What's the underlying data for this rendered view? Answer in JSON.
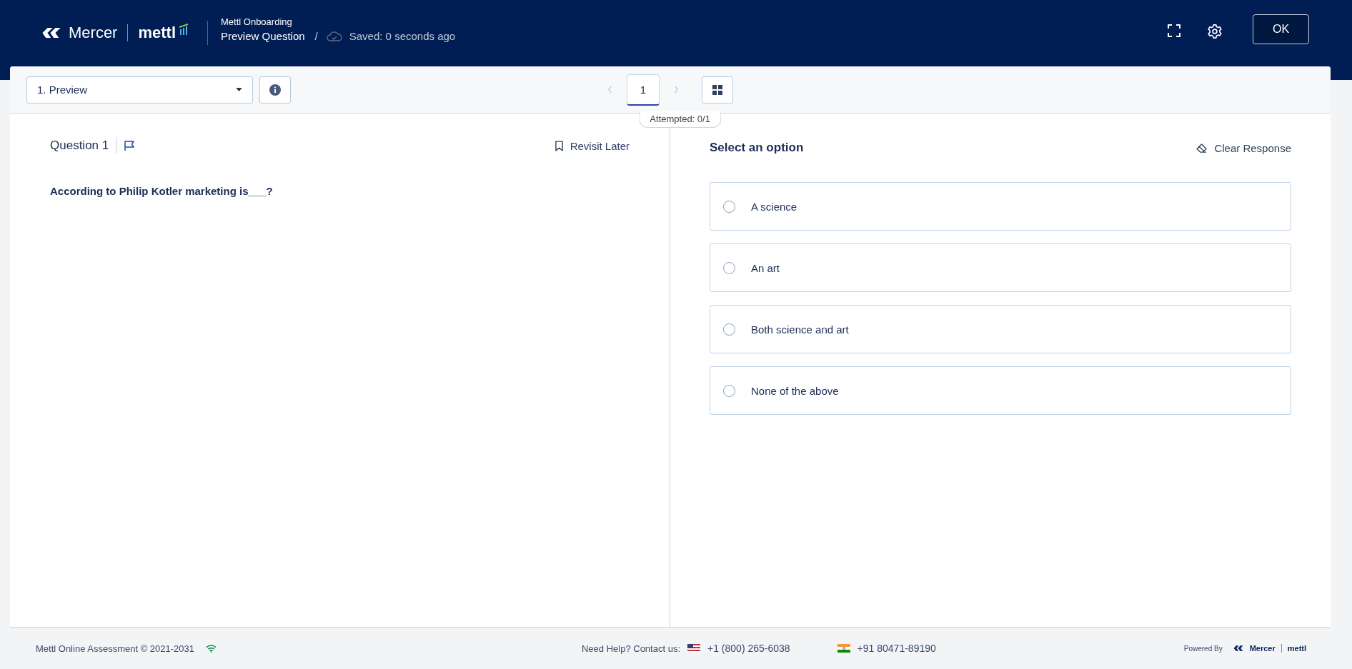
{
  "header": {
    "brand": "Mercer",
    "product": "mettl",
    "test_name": "Mettl Onboarding",
    "page_title": "Preview Question",
    "separator": "/",
    "save_status": "Saved: 0 seconds ago",
    "ok_button": "OK"
  },
  "toolbar": {
    "section_select": "1. Preview",
    "pages": [
      {
        "label": "1",
        "selected": true
      }
    ],
    "attempted": "Attempted: 0/1"
  },
  "question": {
    "title": "Question 1",
    "flagged": false,
    "revisit_label": "Revisit Later",
    "text": "According to Philip Kotler marketing is___?"
  },
  "answers": {
    "title": "Select an option",
    "clear_label": "Clear Response",
    "options": [
      {
        "label": "A science",
        "selected": false
      },
      {
        "label": "An art",
        "selected": false
      },
      {
        "label": "Both science and art",
        "selected": false
      },
      {
        "label": "None of the above",
        "selected": false
      }
    ]
  },
  "footer": {
    "copyright": "Mettl Online Assessment © 2021-2031",
    "help": "Need Help? Contact us:",
    "phones": [
      {
        "kind": "us",
        "number": "+1 (800) 265-6038"
      },
      {
        "kind": "in",
        "number": "+91 80471-89190"
      }
    ],
    "powered_by": "Powered By",
    "brand": "Mercer",
    "product": "mettl"
  }
}
